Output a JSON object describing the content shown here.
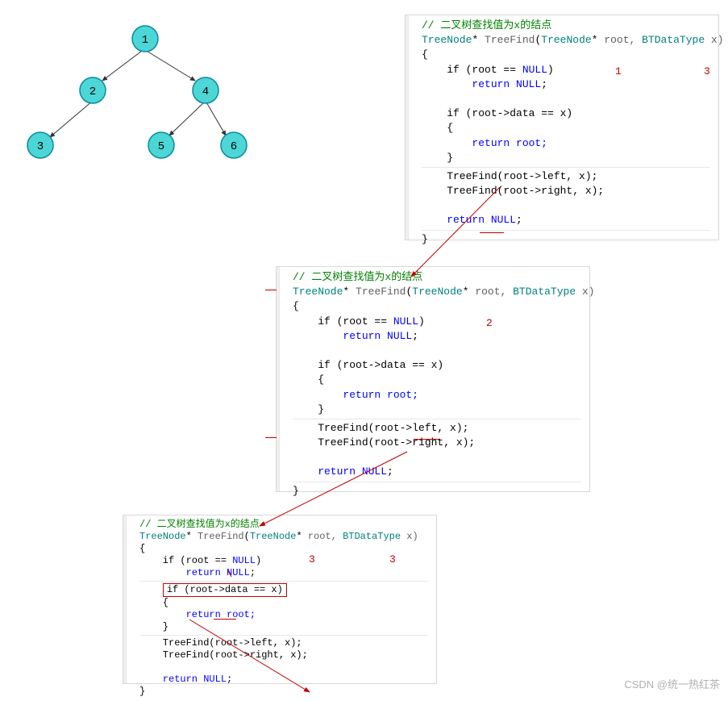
{
  "tree": {
    "nodes": [
      "1",
      "2",
      "3",
      "4",
      "5",
      "6"
    ]
  },
  "code": {
    "comment": "// 二叉树查找值为x的结点",
    "sig_type1": "TreeNode",
    "sig_star1": "*",
    "sig_fname": "TreeFind",
    "sig_open": "(",
    "sig_type2": "TreeNode",
    "sig_star2": "*",
    "sig_param1": " root, ",
    "sig_type3": "BTDataType",
    "sig_param2": " x)",
    "lbrace": "{",
    "if1a": "    if (root == ",
    "if1b": "NULL",
    "if1c": ")",
    "ret1a": "        return ",
    "ret1b": "NULL",
    "ret1c": ";",
    "if2": "    if (root->data == x)",
    "inbrace_l": "    {",
    "ret2": "        return root;",
    "inbrace_r": "    }",
    "call1": "    TreeFind(root->left, x);",
    "call2": "    TreeFind(root->right, x);",
    "ret3a": "    return ",
    "ret3b": "NULL",
    "ret3c": ";",
    "rbrace": "}"
  },
  "annotations": {
    "a1": "1",
    "a2": "2",
    "a3": "3"
  },
  "watermark": "CSDN @统一热红茶"
}
